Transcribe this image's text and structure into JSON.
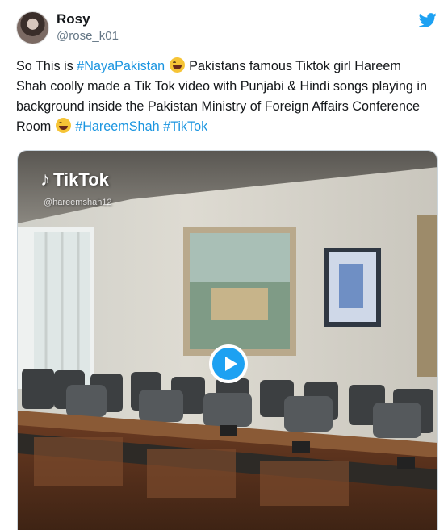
{
  "user": {
    "display_name": "Rosy",
    "handle": "@rose_k01"
  },
  "tweet": {
    "t1": "So This is ",
    "h1": "#NayaPakistan",
    "t2": " Pakistans famous Tiktok girl Hareem Shah coolly made a Tik Tok video with Punjabi & Hindi songs playing in background inside the Pakistan Ministry of Foreign Affairs Conference Room ",
    "h2": "#HareemShah",
    "t3": " ",
    "h3": "#TikTok"
  },
  "media": {
    "watermark": "TikTok",
    "watermark_user": "@hareemshah12"
  },
  "icons": {
    "brand": "twitter-bird-icon",
    "emoji": "face-with-tears-of-joy-icon",
    "play": "play-icon"
  },
  "colors": {
    "link": "#1b95e0",
    "play": "#1da1f2"
  }
}
